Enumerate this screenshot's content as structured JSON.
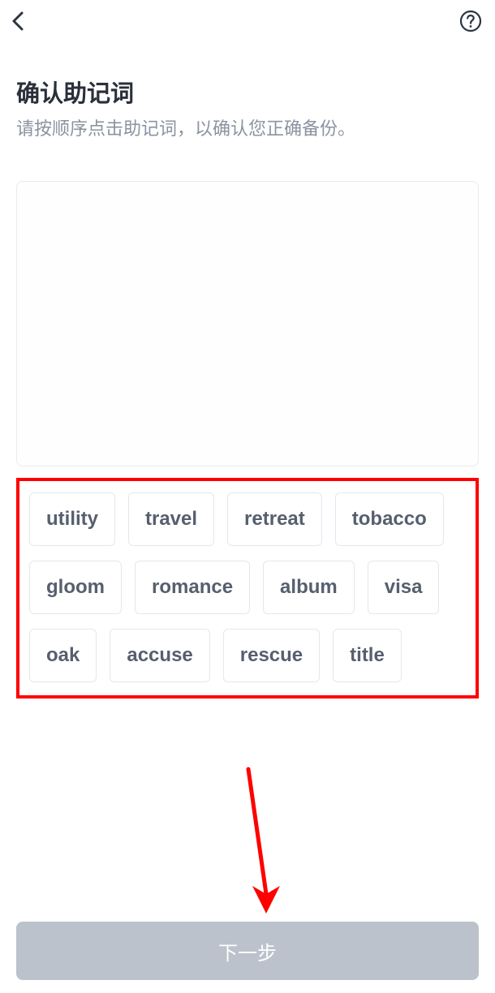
{
  "header": {
    "back": "back",
    "help": "help"
  },
  "title": "确认助记词",
  "subtitle": "请按顺序点击助记词，以确认您正确备份。",
  "words": [
    "utility",
    "travel",
    "retreat",
    "tobacco",
    "gloom",
    "romance",
    "album",
    "visa",
    "oak",
    "accuse",
    "rescue",
    "title"
  ],
  "next_label": "下一步",
  "colors": {
    "highlight_border": "#ff0000",
    "arrow": "#ff0000",
    "button_bg": "#bcc2cb"
  }
}
